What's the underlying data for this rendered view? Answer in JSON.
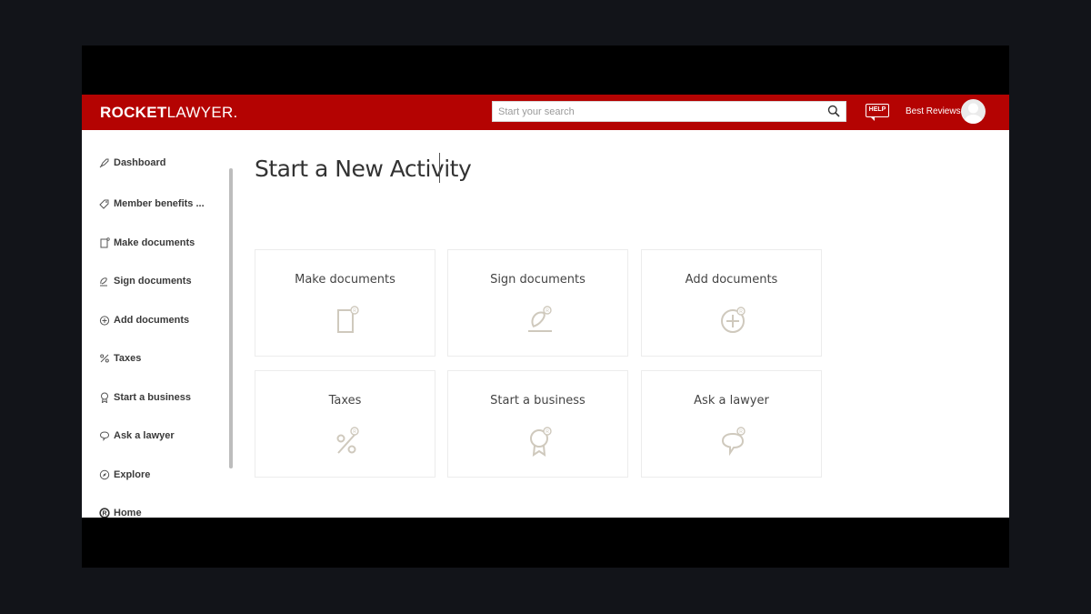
{
  "header": {
    "logo_bold": "ROCKET",
    "logo_light": "LAWYER.",
    "search_placeholder": "Start your search",
    "search_value": "",
    "help_label": "HELP",
    "user_name": "Best Reviews"
  },
  "sidebar": {
    "items": [
      {
        "label": "Dashboard",
        "icon": "rocket-icon"
      },
      {
        "label": "Member benefits ...",
        "icon": "tag-icon"
      },
      {
        "label": "Make documents",
        "icon": "document-icon"
      },
      {
        "label": "Sign documents",
        "icon": "signature-icon"
      },
      {
        "label": "Add documents",
        "icon": "plus-circle-icon"
      },
      {
        "label": "Taxes",
        "icon": "percent-icon"
      },
      {
        "label": "Start a business",
        "icon": "ribbon-icon"
      },
      {
        "label": "Ask a lawyer",
        "icon": "chat-bubble-icon"
      },
      {
        "label": "Explore",
        "icon": "compass-icon"
      },
      {
        "label": "Home",
        "icon": "home-logo-icon"
      }
    ]
  },
  "main": {
    "title": "Start a New Activity",
    "cards": [
      {
        "label": "Make documents",
        "icon": "document-icon"
      },
      {
        "label": "Sign documents",
        "icon": "signature-icon"
      },
      {
        "label": "Add documents",
        "icon": "plus-circle-icon"
      },
      {
        "label": "Taxes",
        "icon": "percent-icon"
      },
      {
        "label": "Start a business",
        "icon": "ribbon-icon"
      },
      {
        "label": "Ask a lawyer",
        "icon": "chat-bubble-icon"
      }
    ]
  },
  "colors": {
    "brand_red": "#b40302",
    "card_icon": "#cfc9bd",
    "text_dark": "#3a3a3a"
  }
}
